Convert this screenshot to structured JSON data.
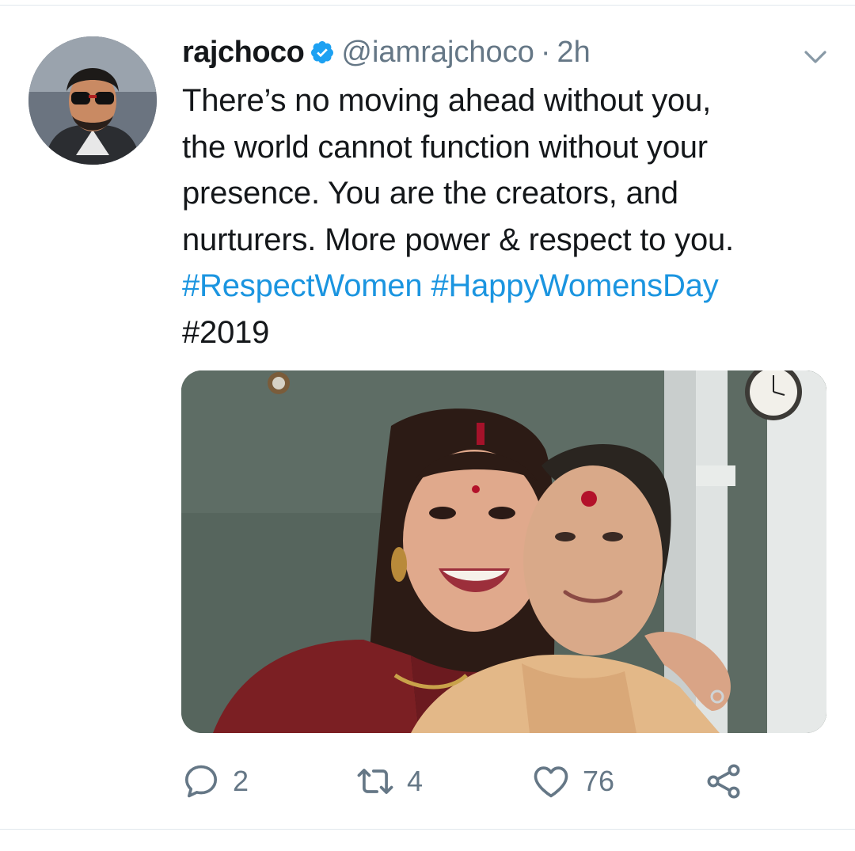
{
  "tweet": {
    "display_name": "rajchoco",
    "handle": "@iamrajchoco",
    "separator": "·",
    "time": "2h",
    "text_lines": [
      "There’s no moving ahead without you,",
      "the world cannot function without your",
      "presence. You are the creators, and",
      "nurturers. More power & respect to you."
    ],
    "hashtags": [
      "#RespectWomen",
      "#HappyWomensDay"
    ],
    "last_line": "#2019"
  },
  "actions": {
    "reply_count": "2",
    "retweet_count": "4",
    "like_count": "76"
  },
  "icons": {
    "verified": "verified-badge-icon",
    "caret": "chevron-down-icon",
    "reply": "reply-icon",
    "retweet": "retweet-icon",
    "like": "heart-icon",
    "share": "share-icon"
  },
  "colors": {
    "text": "#14171a",
    "muted": "#657786",
    "link": "#1b95e0",
    "verified": "#1da1f2"
  }
}
